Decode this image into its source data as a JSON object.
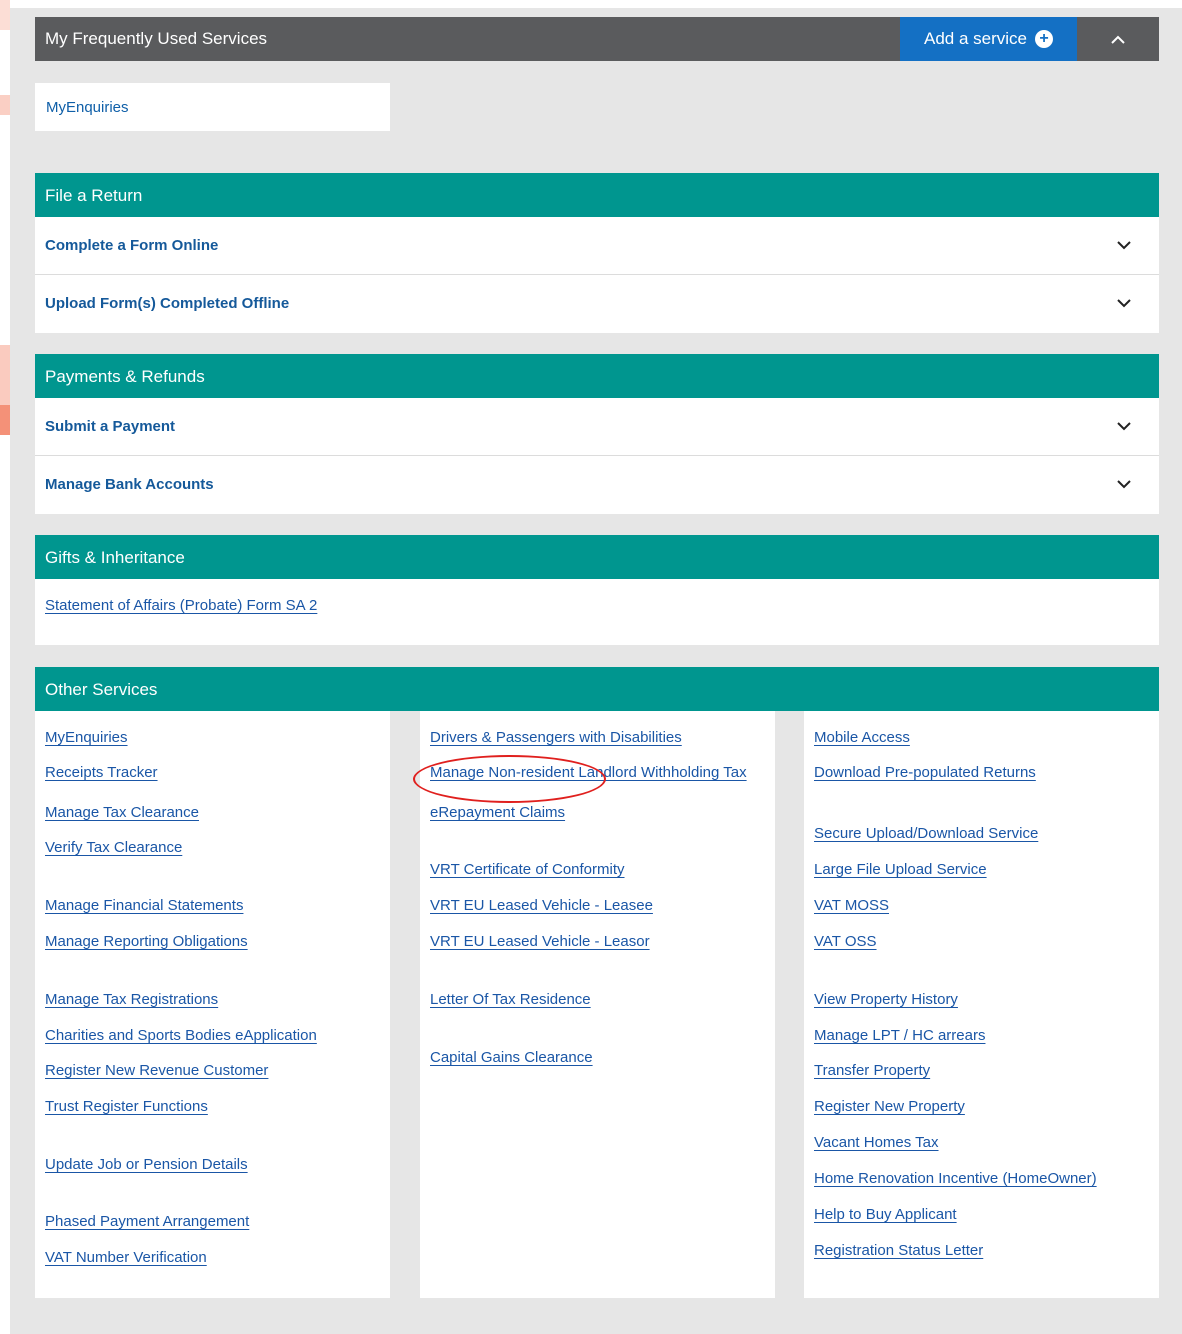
{
  "frequently_used": {
    "title": "My Frequently Used Services",
    "add_service_label": "Add a service",
    "items": [
      "MyEnquiries"
    ]
  },
  "file_a_return": {
    "title": "File a Return",
    "rows": [
      "Complete a Form Online",
      "Upload Form(s) Completed Offline"
    ]
  },
  "payments_refunds": {
    "title": "Payments & Refunds",
    "rows": [
      "Submit a Payment",
      "Manage Bank Accounts"
    ]
  },
  "gifts_inheritance": {
    "title": "Gifts & Inheritance",
    "links": [
      "Statement of Affairs (Probate) Form SA 2"
    ]
  },
  "other_services": {
    "title": "Other Services",
    "col1": [
      "MyEnquiries",
      "Receipts Tracker",
      "Manage Tax Clearance",
      "Verify Tax Clearance",
      "Manage Financial Statements",
      "Manage Reporting Obligations",
      "Manage Tax Registrations",
      "Charities and Sports Bodies eApplication",
      "Register New Revenue Customer",
      "Trust Register Functions",
      "Update Job or Pension Details",
      "Phased Payment Arrangement",
      "VAT Number Verification"
    ],
    "col2": [
      "Drivers & Passengers with Disabilities",
      "Manage Non-resident Landlord Withholding Tax",
      "eRepayment Claims",
      "VRT Certificate of Conformity",
      "VRT EU Leased Vehicle - Leasee",
      "VRT EU Leased Vehicle - Leasor",
      "Letter Of Tax Residence",
      "Capital Gains Clearance"
    ],
    "col3": [
      "Mobile Access",
      "Download Pre-populated Returns",
      "Secure Upload/Download Service",
      "Large File Upload Service",
      "VAT MOSS",
      "VAT OSS",
      "View Property History",
      "Manage LPT / HC arrears",
      "Transfer Property",
      "Register New Property",
      "Vacant Homes Tax",
      "Home Renovation Incentive (HomeOwner)",
      "Help to Buy Applicant",
      "Registration Status Letter"
    ]
  },
  "colors": {
    "teal_header": "#00968f",
    "dark_header": "#5a5b5d",
    "add_button": "#1470c4",
    "link": "#1a56a6",
    "annotation_circle": "#e0201e"
  }
}
